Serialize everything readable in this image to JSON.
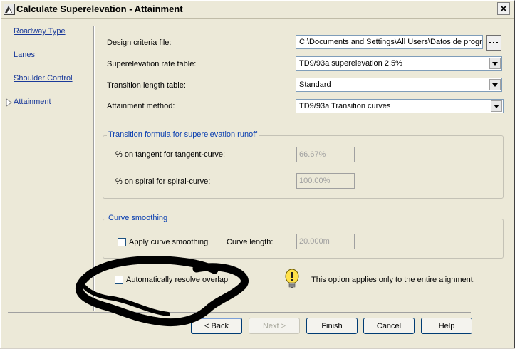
{
  "window": {
    "title": "Calculate Superelevation - Attainment"
  },
  "nav": {
    "items": [
      {
        "label": "Roadway Type"
      },
      {
        "label": "Lanes"
      },
      {
        "label": "Shoulder Control"
      },
      {
        "label": "Attainment"
      }
    ]
  },
  "form": {
    "design_criteria": {
      "label": "Design criteria file:",
      "value": "C:\\Documents and Settings\\All Users\\Datos de progr"
    },
    "rate_table": {
      "label": "Superelevation rate table:",
      "value": "TD9/93a superelevation 2.5%"
    },
    "transition_table": {
      "label": "Transition length table:",
      "value": "Standard"
    },
    "attainment_method": {
      "label": "Attainment method:",
      "value": "TD9/93a Transition curves"
    }
  },
  "transition_group": {
    "title": "Transition formula for superelevation runoff",
    "tangent": {
      "label": "% on tangent for tangent-curve:",
      "value": "66.67%"
    },
    "spiral": {
      "label": "% on spiral for spiral-curve:",
      "value": "100.00%"
    }
  },
  "curve_group": {
    "title": "Curve smoothing",
    "apply_label": "Apply curve smoothing",
    "length_label": "Curve length:",
    "length_value": "20.000m"
  },
  "overlap": {
    "label": "Automatically resolve overlap",
    "note": "This option applies only to the entire alignment."
  },
  "buttons": {
    "back": "< Back",
    "next": "Next >",
    "finish": "Finish",
    "cancel": "Cancel",
    "help": "Help"
  }
}
